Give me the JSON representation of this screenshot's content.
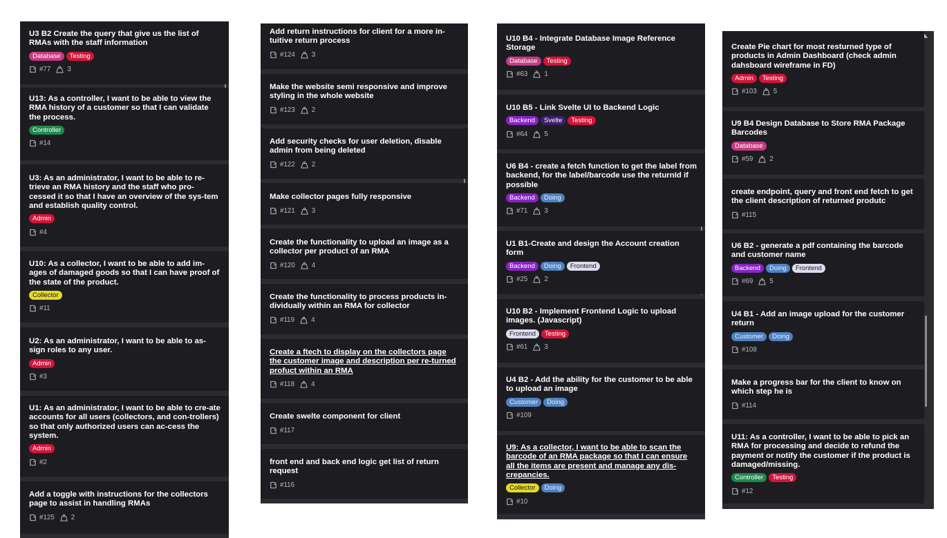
{
  "columns": [
    {
      "cards": [
        {
          "title": "U3 B2 Create the query that give us the list of RMAs with the staff information",
          "tags": [
            "Database",
            "Testing"
          ],
          "issue": "#77",
          "points": "3"
        },
        {
          "title": "U13: As a controller, I want to be able to view the RMA history of a customer so that I can validate the process.",
          "tags": [
            "Controller"
          ],
          "issue": "#14",
          "points": ""
        },
        {
          "title": "U3: As an administrator, I want to be able to re-trieve an RMA history and the staff who pro-cessed it so that I have an overview of the sys-tem and establish quality control.",
          "tags": [
            "Admin"
          ],
          "issue": "#4",
          "points": ""
        },
        {
          "title": "U10: As a collector, I want to be able to add im-ages of damaged goods so that I can have proof of the state of the product.",
          "tags": [
            "Collector"
          ],
          "issue": "#11",
          "points": ""
        },
        {
          "title": "U2: As an administrator, I want to be able to as-sign roles to any user.",
          "tags": [
            "Admin"
          ],
          "issue": "#3",
          "points": ""
        },
        {
          "title": "U1: As an administrator, I want to be able to cre-ate accounts for all users (collectors, and con-trollers) so that only authorized users can ac-cess the system.",
          "tags": [
            "Admin"
          ],
          "issue": "#2",
          "points": ""
        },
        {
          "title": "Add a toggle with instructions for the collectors page to assist in handling RMAs",
          "tags": [],
          "issue": "#125",
          "points": "2"
        }
      ]
    },
    {
      "cards": [
        {
          "title": "Add return instructions for client for a more in-tuitive return process",
          "tags": [],
          "issue": "#124",
          "points": "3"
        },
        {
          "title": "Make the website semi responsive and improve styling in the whole website",
          "tags": [],
          "issue": "#123",
          "points": "2"
        },
        {
          "title": "Add security checks for user deletion, disable admin from being deleted",
          "tags": [],
          "issue": "#122",
          "points": "2"
        },
        {
          "title": "Make collector pages fully responsive",
          "tags": [],
          "issue": "#121",
          "points": "3"
        },
        {
          "title": "Create the functionality to upload an image as a collector per product of an RMA",
          "tags": [],
          "issue": "#120",
          "points": "4"
        },
        {
          "title": "Create the functionality to process products in-dividually within an RMA for collector",
          "tags": [],
          "issue": "#119",
          "points": "4"
        },
        {
          "title": "Create a ftech to display on the collectors page the customer image and description per re-turned profuct within an RMA",
          "tags": [],
          "issue": "#118",
          "points": "4"
        },
        {
          "title": "Create swelte component for client",
          "tags": [],
          "issue": "#117",
          "points": ""
        },
        {
          "title": "front end and back end logic get list of return request",
          "tags": [],
          "issue": "#116",
          "points": ""
        }
      ]
    },
    {
      "cards": [
        {
          "title": "U10 B4 - Integrate Database Image Reference Storage",
          "tags": [
            "Database",
            "Testing"
          ],
          "issue": "#63",
          "points": "1"
        },
        {
          "title": "U10 B5 - Link Svelte UI to Backend Logic",
          "tags": [
            "Backend",
            "Svelte",
            "Testing"
          ],
          "issue": "#64",
          "points": "5"
        },
        {
          "title": "U6 B4 - create a fetch function to get the label from backend, for the label/barcode use the returnId if possible",
          "tags": [
            "Backend",
            "Doing"
          ],
          "issue": "#71",
          "points": "3"
        },
        {
          "title": "U1 B1-Create and design the Account creation form",
          "tags": [
            "Backend",
            "Doing",
            "Frontend"
          ],
          "issue": "#25",
          "points": "2"
        },
        {
          "title": "U10 B2 - Implement Frontend Logic to upload images. (Javascript)",
          "tags": [
            "Frontend",
            "Testing"
          ],
          "issue": "#61",
          "points": "3"
        },
        {
          "title": "U4 B2 - Add the ability for the customer to be able to upload an image",
          "tags": [
            "Customer",
            "Doing"
          ],
          "issue": "#109",
          "points": ""
        },
        {
          "title": "U9: As a collector, I want to be able to scan the barcode of an RMA package so that I can ensure all the items are present and manage any dis-crepancies.",
          "tags": [
            "Collector",
            "Doing"
          ],
          "issue": "#10",
          "points": ""
        }
      ]
    },
    {
      "cards": [
        {
          "title": "Create Pie chart for most resturned type of products in Admin Dashboard (check admin dahsboard wireframe in FD)",
          "tags": [
            "Admin",
            "Testing"
          ],
          "issue": "#103",
          "points": "5"
        },
        {
          "title": "U9 B4 Design Database to Store RMA Package Barcodes",
          "tags": [
            "Database"
          ],
          "issue": "#59",
          "points": "2"
        },
        {
          "title": "create endpoint, query and front end fetch to get the client description of returned produtc",
          "tags": [],
          "issue": "#115",
          "points": ""
        },
        {
          "title": "U6 B2 - generate a pdf containing the barcode and customer name",
          "tags": [
            "Backend",
            "Doing",
            "Frontend"
          ],
          "issue": "#69",
          "points": "5"
        },
        {
          "title": "U4 B1 - Add an image upload for the customer return",
          "tags": [
            "Customer",
            "Doing"
          ],
          "issue": "#108",
          "points": ""
        },
        {
          "title": "Make a progress bar for the client to know on which step he is",
          "tags": [],
          "issue": "#114",
          "points": ""
        },
        {
          "title": "U11: As a controller, I want to be able to pick an RMA for processing and decide to refund the payment or notify the customer if the product is damaged/missing.",
          "tags": [
            "Controller",
            "Testing"
          ],
          "issue": "#12",
          "points": ""
        }
      ]
    }
  ]
}
